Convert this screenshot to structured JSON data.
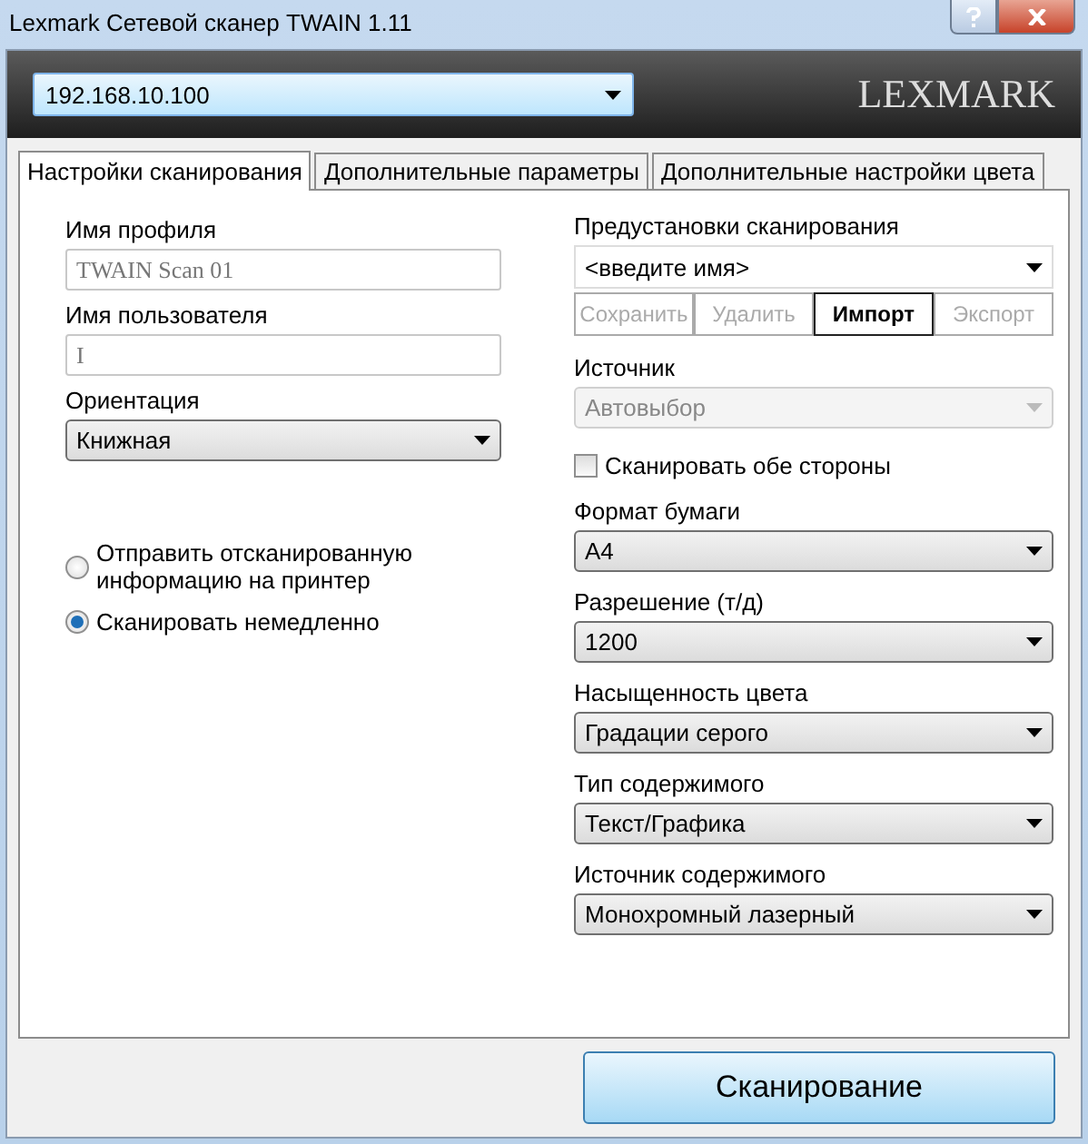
{
  "window": {
    "title": "Lexmark Сетевой сканер TWAIN  1.11"
  },
  "header": {
    "address": "192.168.10.100",
    "logo": "LEXMARK"
  },
  "tabs": [
    {
      "label": "Настройки сканирования",
      "selected": true
    },
    {
      "label": "Дополнительные параметры",
      "selected": false
    },
    {
      "label": "Дополнительные настройки цвета",
      "selected": false
    }
  ],
  "left": [
    {
      "kind": "label",
      "text": "Имя профиля"
    },
    {
      "kind": "text",
      "value": "TWAIN Scan 01",
      "disabled": true
    },
    {
      "kind": "label",
      "text": "Имя пользователя"
    },
    {
      "kind": "text",
      "value": "I",
      "disabled": true
    },
    {
      "kind": "label",
      "text": "Ориентация"
    },
    {
      "kind": "select",
      "value": "Книжная",
      "disabled": false
    },
    {
      "kind": "radio",
      "text": "Отправить отсканированную информацию на принтер",
      "selected": false
    },
    {
      "kind": "radio",
      "text": "Сканировать немедленно",
      "selected": true
    }
  ],
  "right": [
    {
      "kind": "label",
      "text": "Предустановки сканирования"
    },
    {
      "kind": "combo",
      "placeholder": "<введите имя>"
    },
    {
      "kind": "buttons",
      "items": [
        {
          "label": "Сохранить",
          "disabled": true
        },
        {
          "label": "Удалить",
          "disabled": true
        },
        {
          "label": "Импорт",
          "disabled": false
        },
        {
          "label": "Экспорт",
          "disabled": true
        }
      ]
    },
    {
      "kind": "label",
      "text": "Источник"
    },
    {
      "kind": "select",
      "value": "Автовыбор",
      "disabled": true
    },
    {
      "kind": "checkbox",
      "text": "Сканировать обе стороны",
      "checked": false
    },
    {
      "kind": "label",
      "text": "Формат бумаги"
    },
    {
      "kind": "select",
      "value": "A4",
      "disabled": false
    },
    {
      "kind": "label",
      "text": "Разрешение (т/д)"
    },
    {
      "kind": "select",
      "value": "1200",
      "disabled": false
    },
    {
      "kind": "label",
      "text": "Насыщенность цвета"
    },
    {
      "kind": "select",
      "value": "Градации серого",
      "disabled": false
    },
    {
      "kind": "label",
      "text": "Тип содержимого"
    },
    {
      "kind": "select",
      "value": "Текст/Графика",
      "disabled": false
    },
    {
      "kind": "label",
      "text": " Источник содержимого"
    },
    {
      "kind": "select",
      "value": "Монохромный лазерный",
      "disabled": false
    }
  ],
  "scan_button": "Сканирование"
}
